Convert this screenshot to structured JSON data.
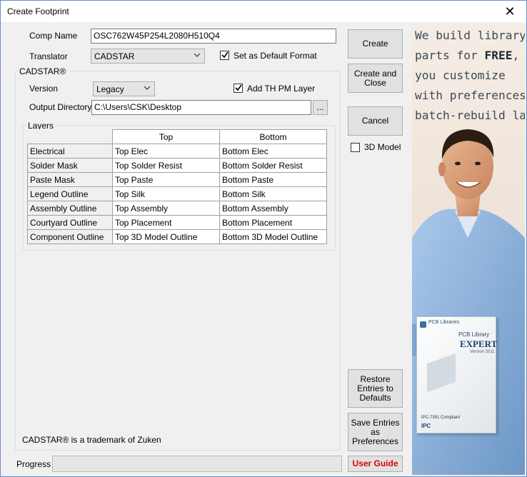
{
  "window": {
    "title": "Create Footprint"
  },
  "comp_name": {
    "label": "Comp Name",
    "value": "OSC762W45P254L2080H510Q4"
  },
  "translator": {
    "label": "Translator",
    "value": "CADSTAR",
    "default_label": "Set as Default Format",
    "default_checked": true
  },
  "cadstar_group": {
    "title": "CADSTAR®",
    "version_label": "Version",
    "version_value": "Legacy",
    "th_pm_label": "Add TH PM Layer",
    "th_pm_checked": true,
    "output_label": "Output Directory",
    "output_value": "C:\\Users\\CSK\\Desktop",
    "browse_label": "..."
  },
  "layers": {
    "title": "Layers",
    "columns": [
      "Top",
      "Bottom"
    ],
    "rows": [
      {
        "name": "Electrical",
        "top": "Top Elec",
        "bottom": "Bottom Elec"
      },
      {
        "name": "Solder Mask",
        "top": "Top Solder Resist",
        "bottom": "Bottom Solder Resist"
      },
      {
        "name": "Paste Mask",
        "top": "Top Paste",
        "bottom": "Bottom Paste"
      },
      {
        "name": "Legend Outline",
        "top": "Top Silk",
        "bottom": "Bottom Silk"
      },
      {
        "name": "Assembly Outline",
        "top": "Top Assembly",
        "bottom": "Bottom Assembly"
      },
      {
        "name": "Courtyard Outline",
        "top": "Top Placement",
        "bottom": "Bottom Placement"
      },
      {
        "name": "Component Outline",
        "top": "Top 3D Model Outline",
        "bottom": "Bottom 3D Model Outline"
      }
    ]
  },
  "trademark": "CADSTAR® is a trademark of Zuken",
  "progress": {
    "label": "Progress",
    "fraction": 0
  },
  "buttons": {
    "create": "Create",
    "create_close": "Create and Close",
    "cancel": "Cancel",
    "restore": "Restore Entries to Defaults",
    "save_prefs": "Save Entries as Preferences",
    "user_guide": "User Guide"
  },
  "model_3d": {
    "label": "3D Model",
    "checked": false
  },
  "ad": {
    "lines": [
      "We build library",
      "parts for FREE,",
      "you customize",
      "with preferences &",
      "batch-rebuild later!"
    ],
    "box_brand": "PCB Libraries",
    "box_title": "PCB Library",
    "box_product": "EXPERT",
    "box_version": "Version 2011",
    "box_compliance": "IPC-7351 Compliant",
    "box_badge": "IPC",
    "colors": {
      "shirt": "#8fb4dc",
      "skin": "#d9a07a",
      "hair": "#2b1d14"
    }
  }
}
